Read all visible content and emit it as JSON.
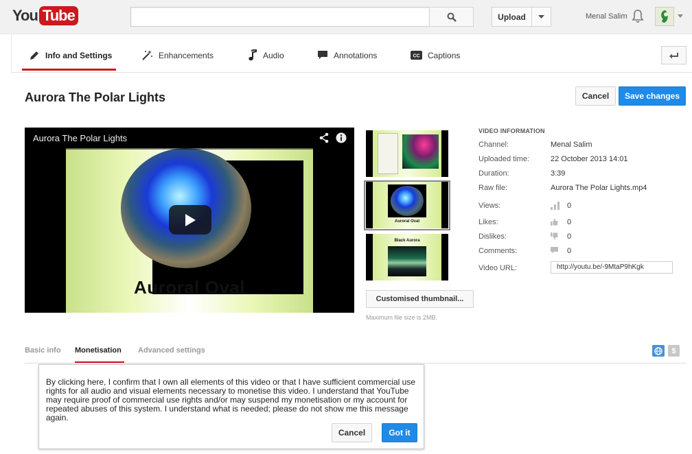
{
  "masthead": {
    "logo_you": "You",
    "logo_tube": "Tube",
    "search_placeholder": "",
    "upload_label": "Upload",
    "username": "Menal Salim"
  },
  "tabs": [
    {
      "label": "Info and Settings",
      "icon": "pencil-icon",
      "active": true
    },
    {
      "label": "Enhancements",
      "icon": "magic-wand-icon",
      "active": false
    },
    {
      "label": "Audio",
      "icon": "music-note-icon",
      "active": false
    },
    {
      "label": "Annotations",
      "icon": "speech-bubble-icon",
      "active": false
    },
    {
      "label": "Captions",
      "icon": "cc-icon",
      "active": false
    }
  ],
  "page": {
    "title": "Aurora The Polar Lights",
    "cancel_label": "Cancel",
    "save_label": "Save changes"
  },
  "player": {
    "title": "Aurora The Polar Lights",
    "slide_caption": "Auroral Oval"
  },
  "thumbnails": [
    {
      "label": "",
      "selected": false
    },
    {
      "label": "Auroral Oval",
      "selected": true
    },
    {
      "label": "Black Aurora",
      "selected": false
    }
  ],
  "thumbnail_actions": {
    "custom_label": "Customised thumbnail...",
    "max_size": "Maximum file size is 2MB."
  },
  "video_info": {
    "heading": "VIDEO INFORMATION",
    "channel_label": "Channel:",
    "channel": "Menal Salim",
    "uploaded_label": "Uploaded time:",
    "uploaded": "22 October 2013 14:01",
    "duration_label": "Duration:",
    "duration": "3:39",
    "raw_label": "Raw file:",
    "raw_file": "Aurora The Polar Lights.mp4",
    "views_label": "Views:",
    "views": "0",
    "likes_label": "Likes:",
    "likes": "0",
    "dislikes_label": "Dislikes:",
    "dislikes": "0",
    "comments_label": "Comments:",
    "comments": "0",
    "url_label": "Video URL:",
    "url": "http://youtu.be/-9MtaP9hKgk"
  },
  "subtabs": [
    {
      "label": "Basic info",
      "active": false
    },
    {
      "label": "Monetisation",
      "active": true
    },
    {
      "label": "Advanced settings",
      "active": false
    }
  ],
  "dialog": {
    "text": "By clicking here, I confirm that I own all elements of this video or that I have sufficient commercial use rights for all audio and visual elements necessary to monetise this video. I understand that YouTube may require proof of commercial use rights and/or may suspend my monetisation or my account for repeated abuses of this system. I understand what is needed; please do not show me this message again.",
    "cancel_label": "Cancel",
    "ok_label": "Got it"
  },
  "icons": {
    "dollar_symbol": "$"
  },
  "colors": {
    "brand_red": "#cc181e",
    "primary_blue": "#1f8ae8"
  }
}
